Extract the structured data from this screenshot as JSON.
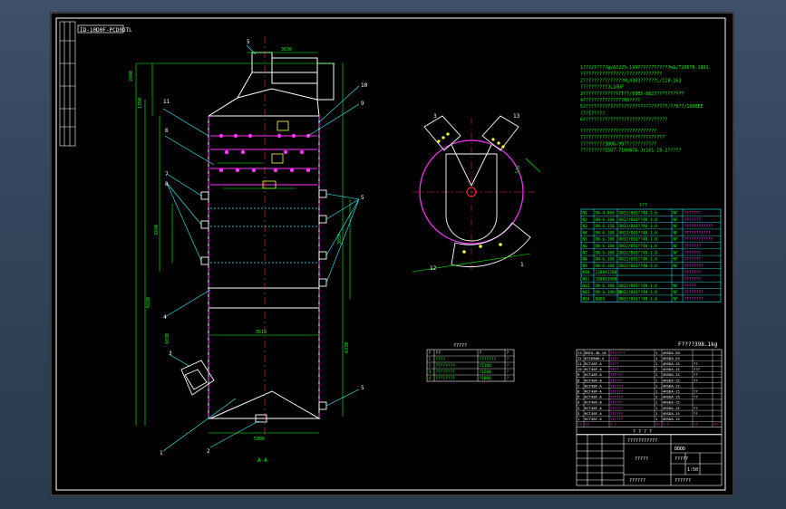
{
  "drawing": {
    "code_box": "ID-10D0F-PCD0DTL",
    "view_label": "A-A",
    "weight_text": "F????398.1kg",
    "dims": {
      "top_width": "3630",
      "stack_height": "2800",
      "left_h1": "1350",
      "mid_dim": "3240",
      "bottom_dim": "5300",
      "total_height": "6830",
      "side_dim": "1030",
      "right_dim": "3850",
      "base_dim": "4330",
      "inner_d": "3510",
      "radius_dim": "570"
    },
    "callouts": [
      "5",
      "6",
      "11",
      "6",
      "7",
      "8",
      "9",
      "8",
      "10",
      "9",
      "5",
      "4",
      "3",
      "1",
      "2",
      "5",
      "3",
      "13",
      "12",
      "1"
    ],
    "notes": [
      "1???27????@/A7J25-1997????7??????mG/T2O678-1891",
      "  ????????????????/?????????????",
      "2???????????????0L4303??????L/119-163",
      "  ??????????JL10UF",
      "3??????????????T??/0985-8027??????????",
      "4???????????????00????",
      "5???????????????????????????????/??0??/1000EE",
      "  ???1?????",
      "6???????????????????????????????"
    ],
    "notes2": [
      "  ????????????????????????????",
      "7??????????????????????????????",
      "  ?????????3806-99????????????",
      "  ?????????5507-710087A-Jr101-19-2?????"
    ]
  },
  "nozzle_table": {
    "title": "???",
    "rows": [
      [
        "N1",
        "DN-4-800",
        "DN32/D01??48-1.0",
        "NF",
        "???????"
      ],
      [
        "N2",
        "DN-6-100",
        "DN32/D01??48-1.0",
        "NF",
        "???????"
      ],
      [
        "N3",
        "DN-6-150",
        "DN32/D01??48-1.0",
        "NF",
        "????????????"
      ],
      [
        "N4",
        "DN-6-100",
        "DN32/D01??48-1.0",
        "NF",
        "???????????"
      ],
      [
        "N5",
        "DN-6-100",
        "DN32/D01??48-1.0",
        "NF",
        "????????????"
      ],
      [
        "N6",
        "DN-6-100",
        "DN32/D01??48-1.0",
        "NF",
        "???????"
      ],
      [
        "N7",
        "DN-6-100",
        "DN32/D01??48-1.0",
        "NF",
        "???????"
      ],
      [
        "N8",
        "DN-6-100",
        "DN32/D01??48-1.0",
        "NF",
        "???????"
      ],
      [
        "N9",
        "DN-6-100",
        "DN32/D01??48-1.0",
        "NF",
        "????????"
      ],
      [
        "N10",
        "1200X1200",
        "",
        "",
        "???????"
      ],
      [
        "N11",
        "1000X1000",
        "",
        "",
        "???????"
      ],
      [
        "N12",
        "DN-6-100",
        "DN32/D01??48-1.0",
        "NF",
        "?????"
      ],
      [
        "N13",
        "DN-6-100/50",
        "DN32/D01??48-1.0",
        "NF",
        "????????"
      ],
      [
        "N14",
        "DN50",
        "DN32/D01??48-1.0",
        "NF",
        "????????"
      ]
    ]
  },
  "small_table": {
    "title": "?????",
    "headers": [
      "?",
      "??",
      "?",
      "?"
    ],
    "rows": [
      [
        "1",
        "????",
        "???????",
        "?"
      ],
      [
        "2",
        "????????",
        "?1100",
        "?"
      ],
      [
        "3",
        "????????",
        "?1200",
        "?"
      ],
      [
        "4",
        "????????",
        "?1000",
        "?"
      ]
    ]
  },
  "parts_list": {
    "rows": [
      [
        "13",
        "DNTA-4D-10",
        "???????",
        "1",
        "4RSDA-28",
        "",
        ""
      ],
      [
        "12",
        "DTCH800-4",
        "????",
        "1",
        "4RSDA-25",
        "",
        ""
      ],
      [
        "11",
        "RCT48F-A",
        "????",
        "1",
        "4RSDA-15",
        "??",
        ""
      ],
      [
        "10",
        "RCT48F-A",
        "????",
        "2",
        "4RSDA-15",
        "???",
        ""
      ],
      [
        "9",
        "RCT48F-A",
        "??????",
        "1",
        "4RSDA-15",
        "??",
        ""
      ],
      [
        "8",
        "RCT48F-A",
        "??????",
        "1",
        "4RSDA-15",
        "??",
        ""
      ],
      [
        "7",
        "RCT48F-A",
        "??????",
        "1",
        "4RSDA-15",
        "",
        ""
      ],
      [
        "6",
        "RCT48F-A",
        "??????",
        "1",
        "4RSDA-15",
        "??",
        ""
      ],
      [
        "5",
        "RCT48F-A",
        "??????",
        "2",
        "4RSDA-15",
        "??",
        ""
      ],
      [
        "4",
        "RCT48F-A",
        "??????",
        "1",
        "4RSDA-15",
        "",
        ""
      ],
      [
        "3",
        "RCT48F-A",
        "??????",
        "1",
        "4RSDA-15",
        "??",
        ""
      ],
      [
        "2",
        "RCT48F-A",
        "??????",
        "1",
        "4RSDA-15",
        "??",
        ""
      ],
      [
        "1",
        "RCT48F-A",
        "??????",
        "1",
        "4RSDA-15",
        "",
        ""
      ]
    ],
    "header": [
      "??",
      "??",
      "?   ?",
      "??",
      "?   ?",
      "??",
      "??"
    ],
    "footer": "? ? ? ?"
  },
  "title_block": {
    "project": "???????????",
    "drawing_name": "?????",
    "code": "??????",
    "drawing_no": "??????",
    "scale_label": "?????",
    "scale": "1:50",
    "sheet": "DDDD",
    "company": "?????????"
  },
  "colors": {
    "background": "#000000",
    "frame": "#ffffff",
    "outline": "#ffffff",
    "dimension": "#00ff00",
    "magenta": "#ff33ff",
    "cyan": "#33ffff",
    "red": "#ff3030",
    "yellow": "#ffff33"
  }
}
